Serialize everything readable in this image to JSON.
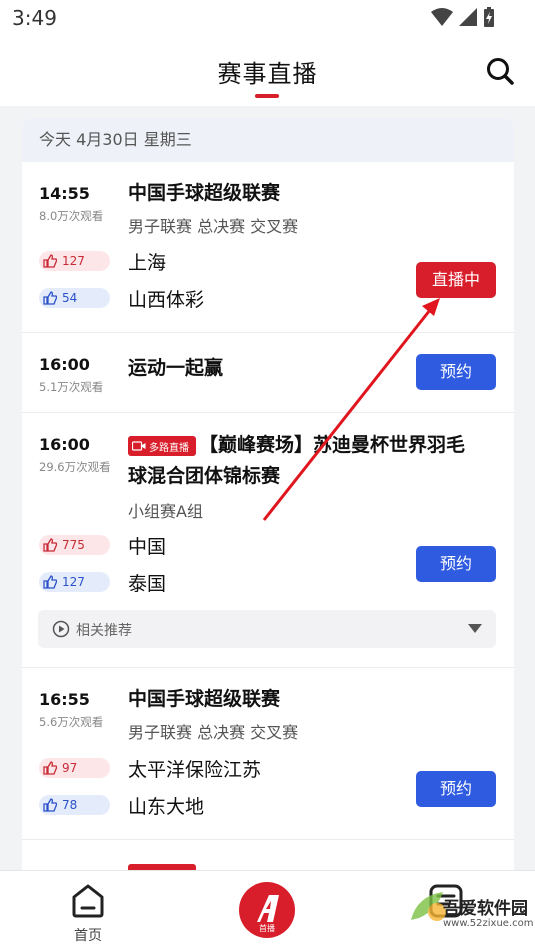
{
  "status": {
    "time": "3:49"
  },
  "header": {
    "title": "赛事直播"
  },
  "date_label": "今天  4月30日 星期三",
  "matches": [
    {
      "time": "14:55",
      "views": "8.0万次观看",
      "title": "中国手球超级联赛",
      "subtitle": "男子联赛 总决赛 交叉赛",
      "team_a": {
        "name": "上海",
        "likes": "127"
      },
      "team_b": {
        "name": "山西体彩",
        "likes": "54"
      },
      "button": "直播中"
    },
    {
      "time": "16:00",
      "views": "5.1万次观看",
      "title": "运动一起赢",
      "button": "预约"
    },
    {
      "time": "16:00",
      "views": "29.6万次观看",
      "badge": "多路直播",
      "title_line1": "【巅峰赛场】苏迪曼杯世界羽毛",
      "title_line2": "球混合团体锦标赛",
      "subtitle": "小组赛A组",
      "team_a": {
        "name": "中国",
        "likes": "775"
      },
      "team_b": {
        "name": "泰国",
        "likes": "127"
      },
      "button": "预约",
      "related": "相关推荐"
    },
    {
      "time": "16:55",
      "views": "5.6万次观看",
      "title": "中国手球超级联赛",
      "subtitle": "男子联赛 总决赛 交叉赛",
      "team_a": {
        "name": "太平洋保险江苏",
        "likes": "97"
      },
      "team_b": {
        "name": "山东大地",
        "likes": "78"
      },
      "button": "预约"
    }
  ],
  "tabbar": {
    "home": "首页",
    "center": "首播"
  },
  "watermark": {
    "name": "吾爱软件园",
    "url": "www.52zixue.com"
  },
  "colors": {
    "accent_red": "#d81e2a",
    "accent_blue": "#2f5be0"
  }
}
